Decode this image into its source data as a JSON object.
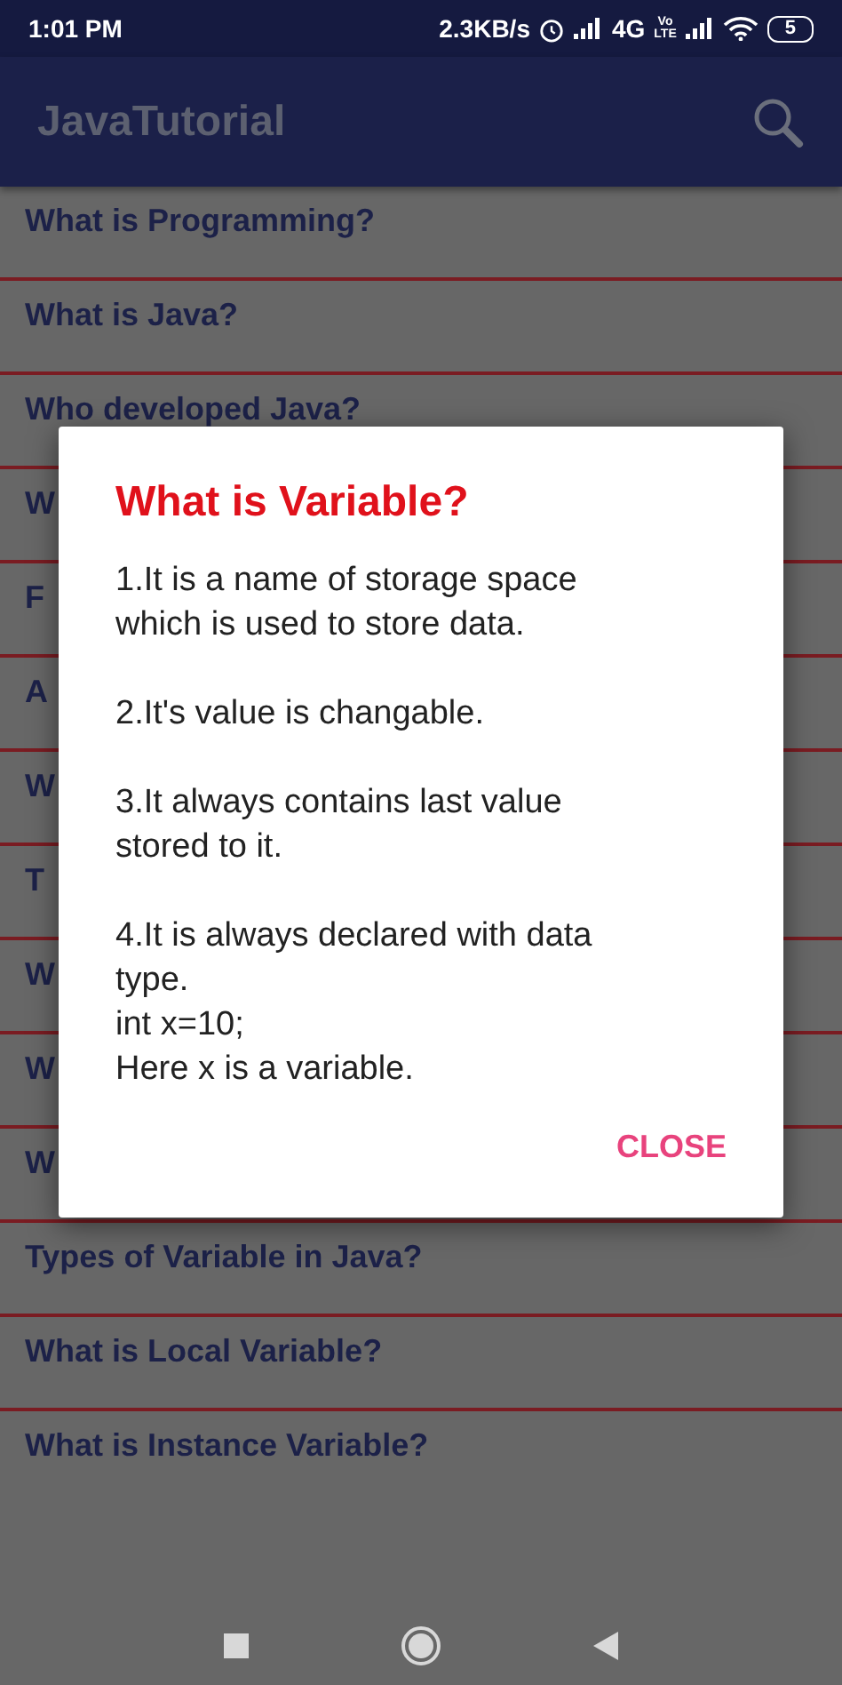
{
  "status_bar": {
    "time": "1:01 PM",
    "speed": "2.3KB/s",
    "network": "4G",
    "volte": [
      "Vo",
      "LTE"
    ],
    "battery": "5"
  },
  "app_bar": {
    "title": "JavaTutorial"
  },
  "list": [
    {
      "text": "What is Programming?"
    },
    {
      "text": "What is Java?"
    },
    {
      "text": "Who developed Java?"
    },
    {
      "text": "W"
    },
    {
      "text": "F"
    },
    {
      "text": "A"
    },
    {
      "text": "W"
    },
    {
      "text": "T"
    },
    {
      "text": "W"
    },
    {
      "text": "W"
    },
    {
      "text": "W"
    },
    {
      "text": "Types of  Variable in Java?"
    },
    {
      "text": "What is Local Variable?"
    },
    {
      "text": "What is Instance Variable?"
    }
  ],
  "dialog": {
    "title": "What is Variable?",
    "paragraphs": [
      "1.It is a name of storage space which is used to store data.",
      "2.It's value is changable.",
      "3.It always contains last value stored to it.",
      "4.It is always declared with data type.\nint x=10;\nHere x is a variable."
    ],
    "button": "CLOSE"
  }
}
